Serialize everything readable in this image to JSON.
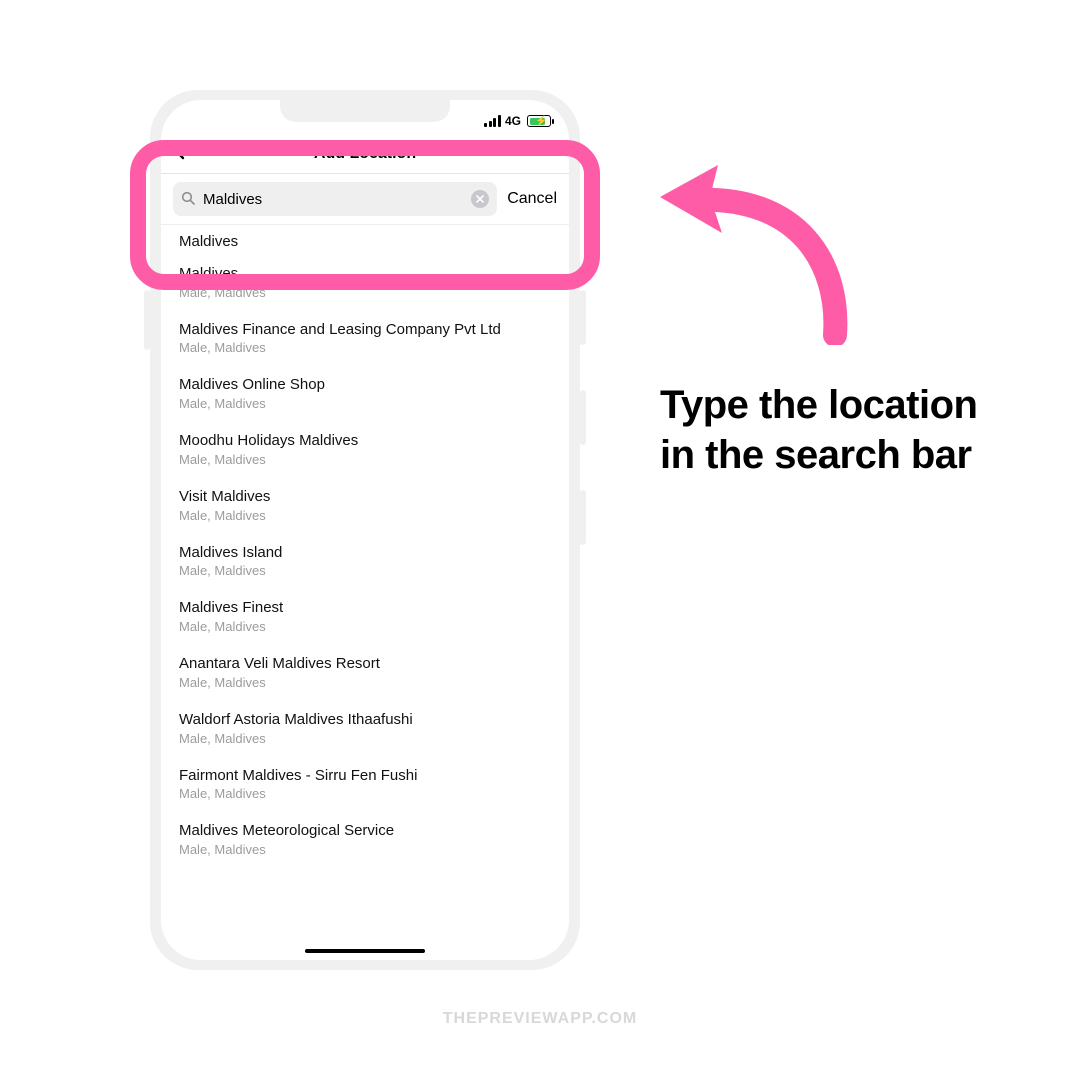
{
  "status": {
    "network": "4G"
  },
  "header": {
    "title": "Add Location"
  },
  "search": {
    "value": "Maldives",
    "cancel": "Cancel"
  },
  "results": [
    {
      "name": "Maldives",
      "sub": ""
    },
    {
      "name": "Maldives",
      "sub": "Male, Maldives"
    },
    {
      "name": "Maldives Finance and Leasing Company Pvt Ltd",
      "sub": "Male, Maldives"
    },
    {
      "name": "Maldives Online Shop",
      "sub": "Male, Maldives"
    },
    {
      "name": "Moodhu Holidays Maldives",
      "sub": "Male, Maldives"
    },
    {
      "name": "Visit Maldives",
      "sub": "Male, Maldives"
    },
    {
      "name": "Maldives Island",
      "sub": "Male, Maldives"
    },
    {
      "name": "Maldives Finest",
      "sub": "Male, Maldives"
    },
    {
      "name": "Anantara Veli Maldives Resort",
      "sub": "Male, Maldives"
    },
    {
      "name": "Waldorf Astoria Maldives Ithaafushi",
      "sub": "Male, Maldives"
    },
    {
      "name": "Fairmont Maldives - Sirru Fen Fushi",
      "sub": "Male, Maldives"
    },
    {
      "name": "Maldives Meteorological Service",
      "sub": "Male, Maldives"
    }
  ],
  "caption": "Type the location in the search bar",
  "watermark": "THEPREVIEWAPP.COM",
  "colors": {
    "accent": "#ff5ca8"
  }
}
